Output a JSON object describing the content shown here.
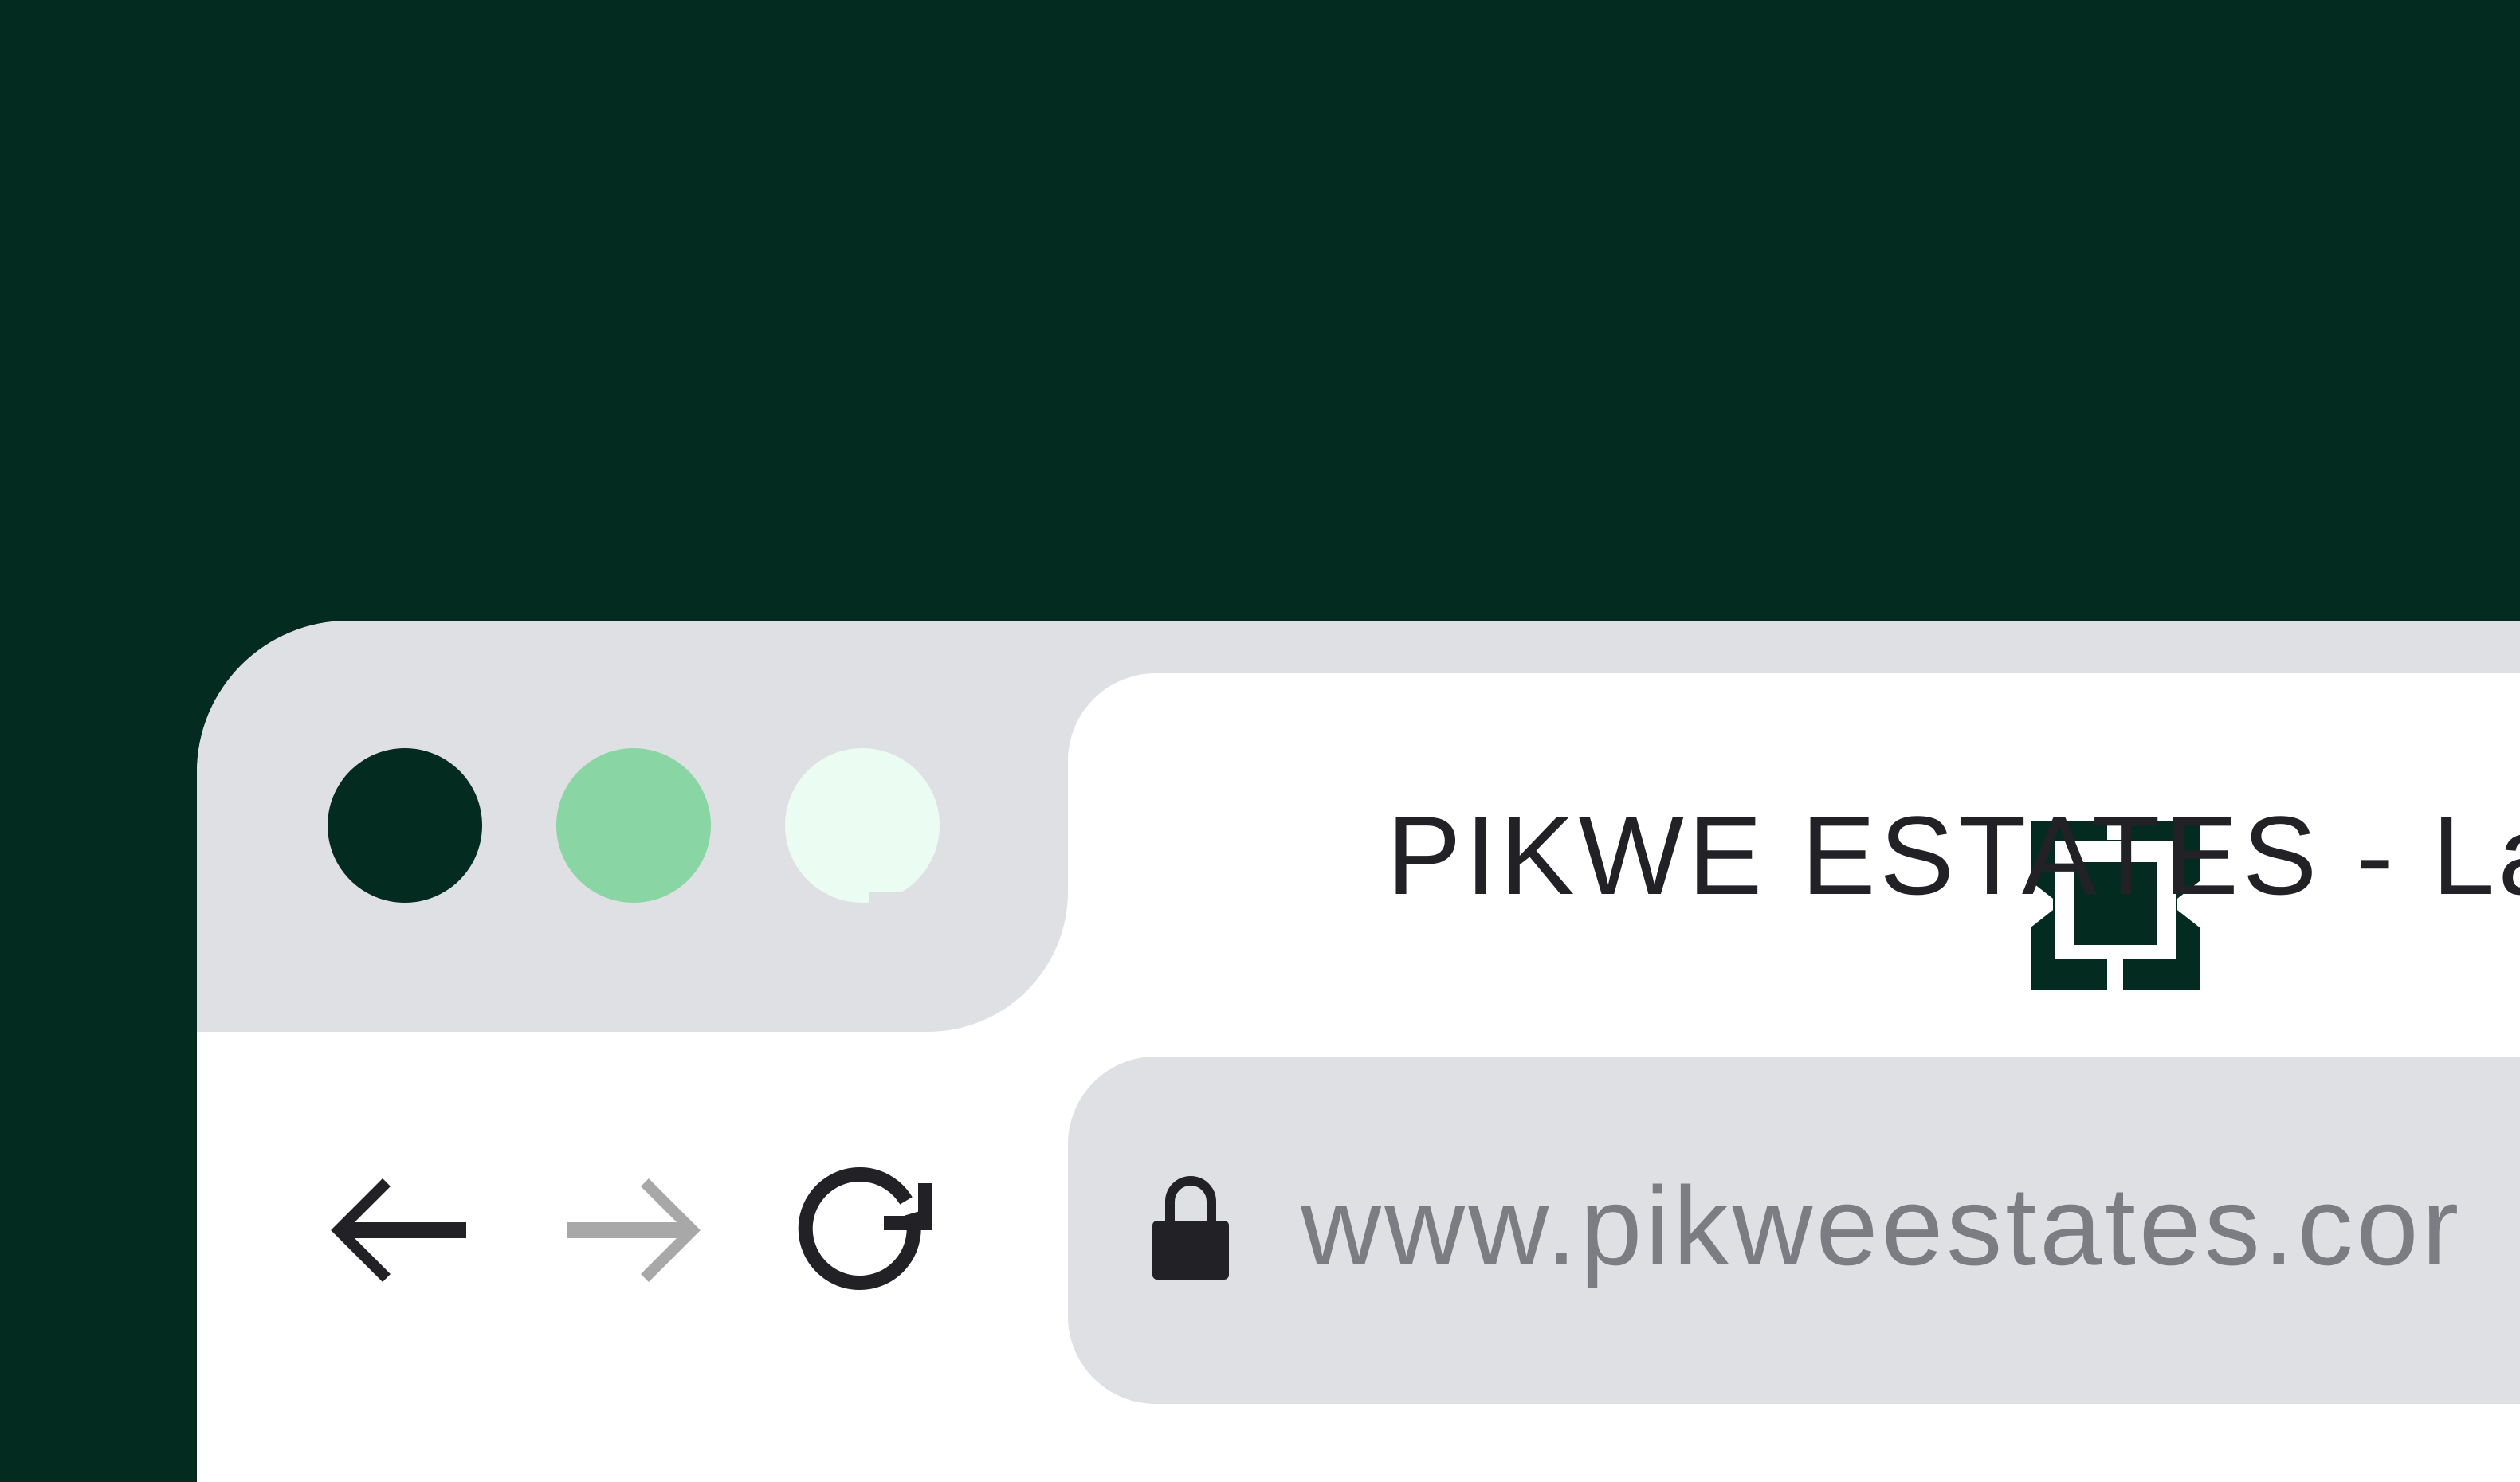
{
  "window": {
    "controls": [
      {
        "name": "close",
        "color": "#032b1f"
      },
      {
        "name": "minimize",
        "color": "#89d5a3"
      },
      {
        "name": "zoom",
        "color": "#ebfcf3"
      }
    ]
  },
  "tab": {
    "favicon": "pikwe-estates-logo-icon",
    "title": "PIKWE ESTATES - Lan"
  },
  "toolbar": {
    "back": {
      "icon": "arrow-left-icon",
      "state": "enabled"
    },
    "forward": {
      "icon": "arrow-right-icon",
      "state": "disabled"
    },
    "reload": {
      "icon": "reload-icon"
    }
  },
  "address_bar": {
    "lock_icon": "lock-icon",
    "url": "www.pikweestates.cor"
  },
  "colors": {
    "background": "#032b1f",
    "chrome": "#dfe0e4",
    "surface": "#ffffff",
    "text": "#222226",
    "url_text": "#7c7d82",
    "disabled_icon": "#a8a8a8"
  }
}
